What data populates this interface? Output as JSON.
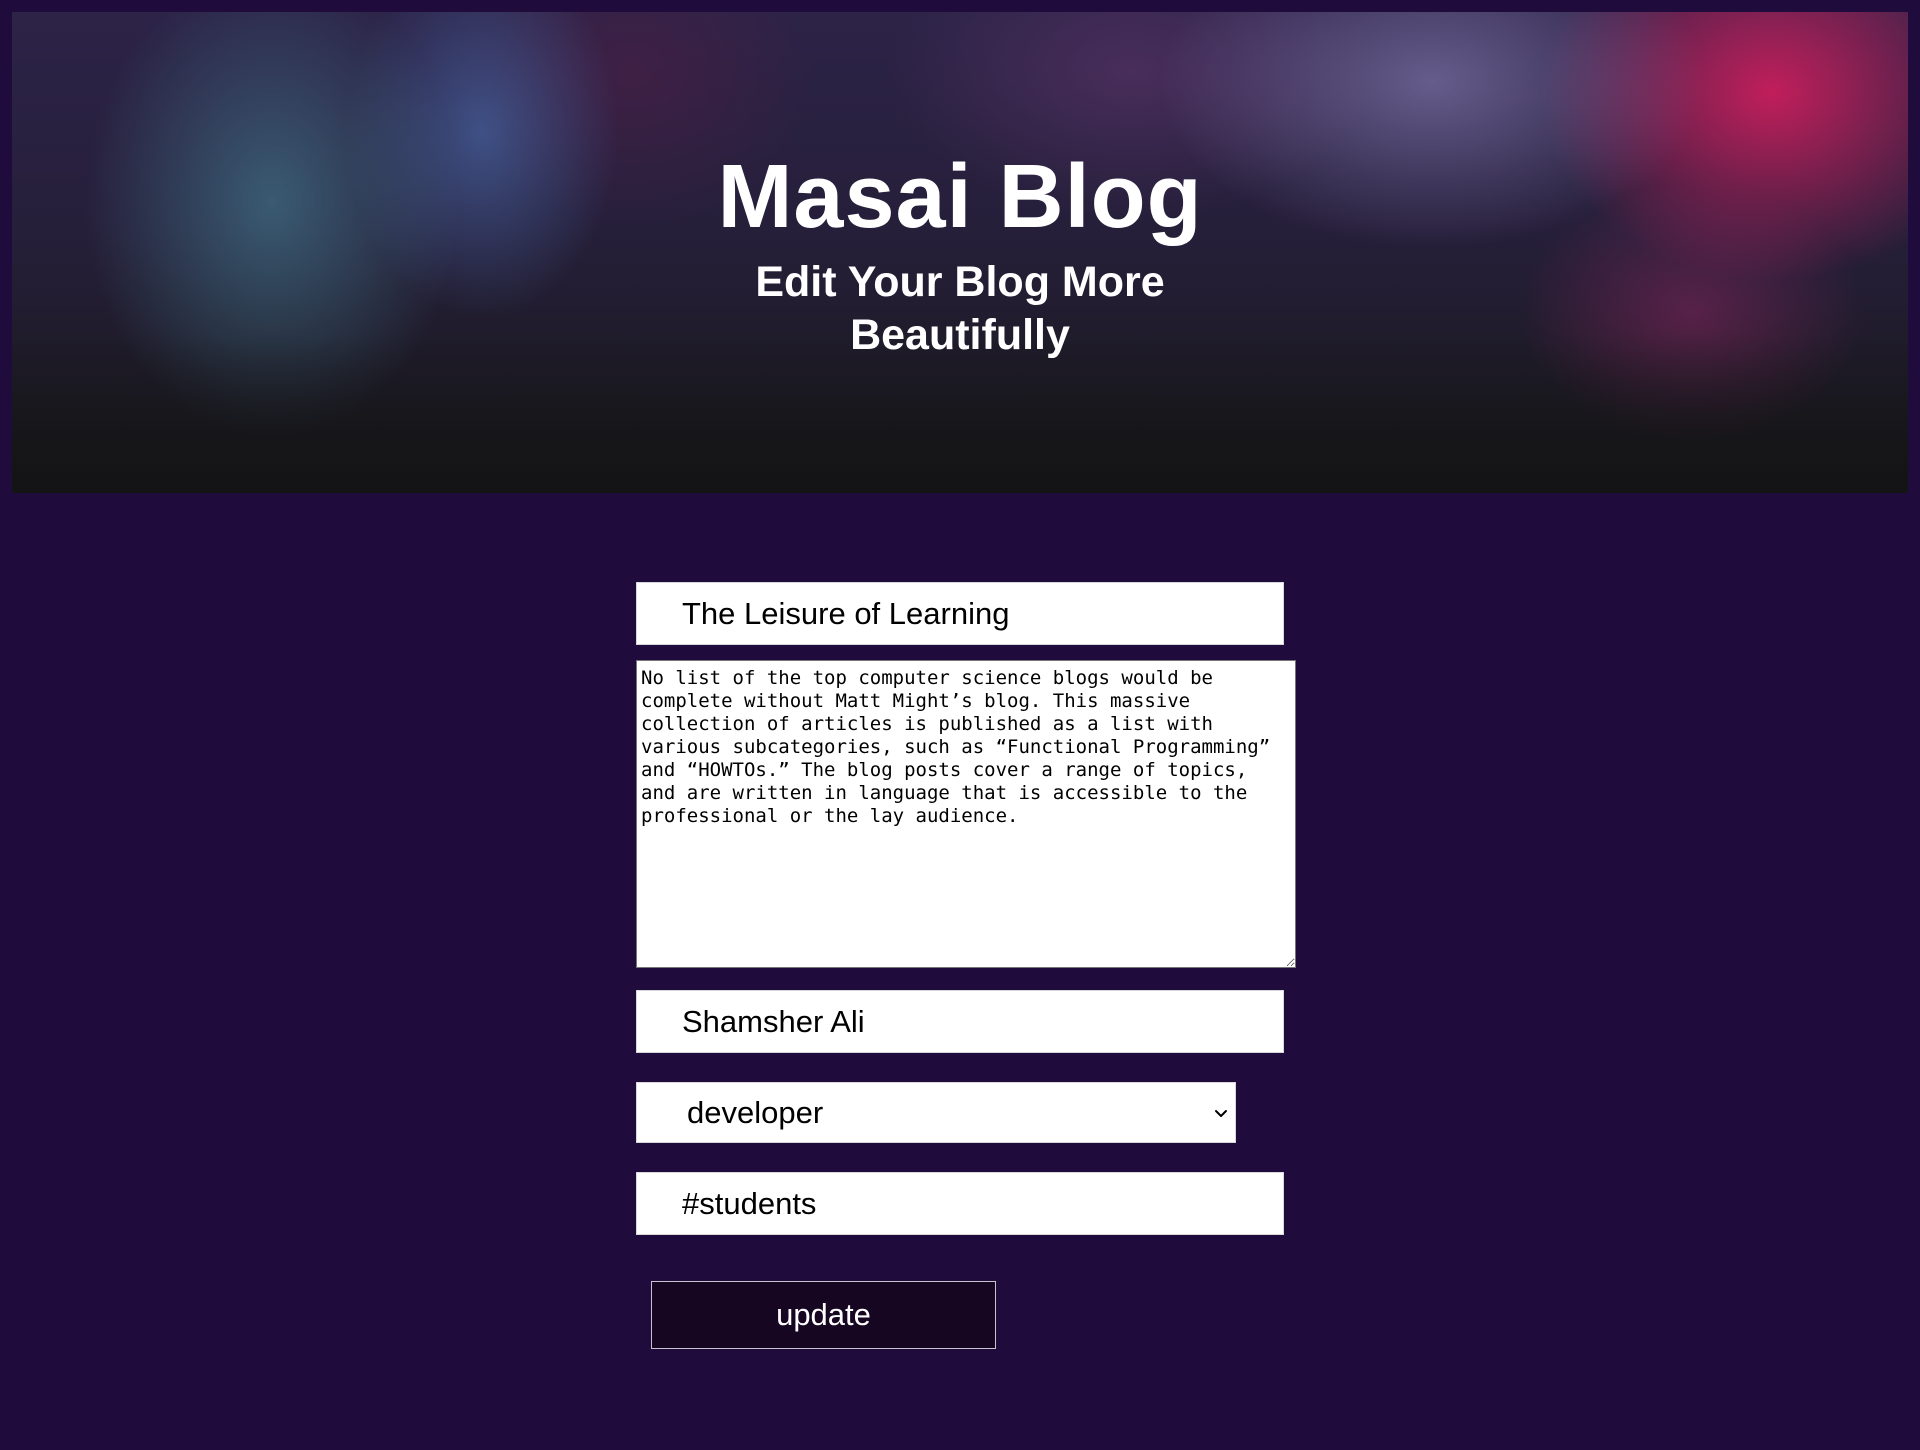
{
  "header": {
    "title": "Masai Blog",
    "subtitle": "Edit Your Blog More Beautifully"
  },
  "form": {
    "title_value": "The Leisure of Learning",
    "content_value": "No list of the top computer science blogs would be complete without Matt Might’s blog. This massive collection of articles is published as a list with various subcategories, such as “Functional Programming” and “HOWTOs.” The blog posts cover a range of topics, and are written in language that is accessible to the professional or the lay audience.",
    "author_value": "Shamsher Ali",
    "category_value": "developer",
    "category_icon": "chevron-down-icon",
    "tag_value": "#students",
    "update_label": "update"
  },
  "colors": {
    "page_background": "#1f0c3c",
    "button_background": "#170622",
    "banner_accent": "#dc1e5f"
  }
}
